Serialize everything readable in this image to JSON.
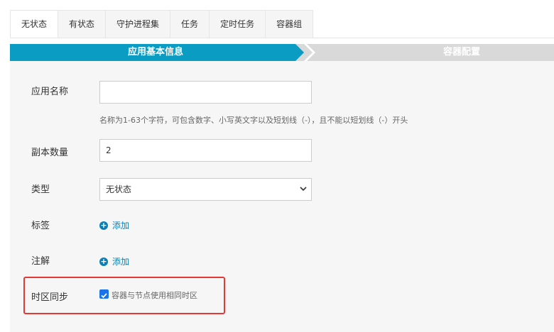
{
  "tabs": [
    "无状态",
    "有状态",
    "守护进程集",
    "任务",
    "定时任务",
    "容器组"
  ],
  "active_tab": 0,
  "steps": {
    "step1": "应用基本信息",
    "step2": "容器配置"
  },
  "form": {
    "app_name": {
      "label": "应用名称",
      "value": "",
      "help": "名称为1-63个字符，可包含数字、小写英文字以及短划线（-），且不能以短划线（-）开头"
    },
    "replicas": {
      "label": "副本数量",
      "value": "2"
    },
    "type": {
      "label": "类型",
      "selected": "无状态"
    },
    "tags": {
      "label": "标签",
      "add_label": "添加"
    },
    "annotations": {
      "label": "注解",
      "add_label": "添加"
    },
    "timezone_sync": {
      "label": "时区同步",
      "checked": true,
      "checkbox_label": "容器与节点使用相同时区"
    }
  },
  "colors": {
    "accent": "#0a9cc3",
    "link": "#0a7fb5",
    "highlight": "#e53935",
    "checkbox": "#1a73e8"
  }
}
